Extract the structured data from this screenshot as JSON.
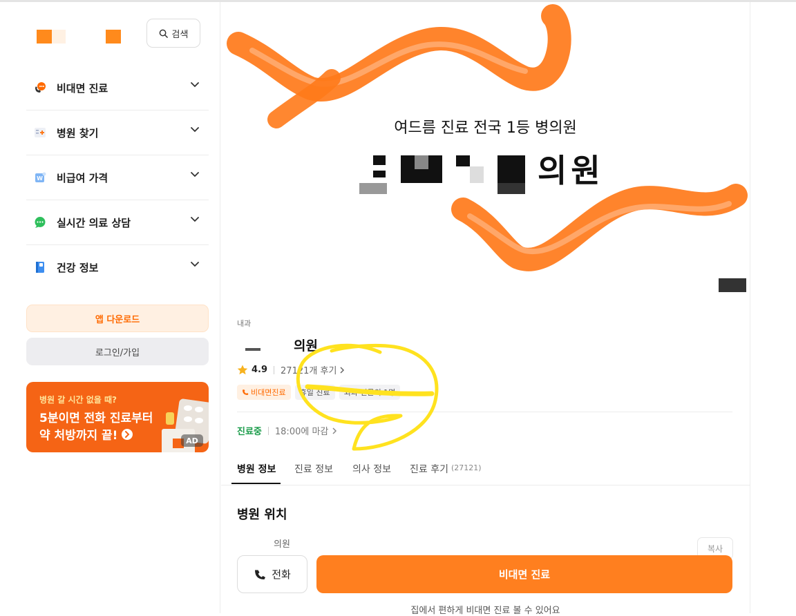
{
  "search": {
    "label": "검색"
  },
  "menu": [
    {
      "label": "비대면 진료",
      "icon": "phone-chat-icon"
    },
    {
      "label": "병원 찾기",
      "icon": "hospital-search-icon"
    },
    {
      "label": "비급여 가격",
      "icon": "price-tag-icon"
    },
    {
      "label": "실시간 의료 상담",
      "icon": "chat-bubble-icon"
    },
    {
      "label": "건강 정보",
      "icon": "book-icon"
    }
  ],
  "buttons": {
    "app_download": "앱 다운로드",
    "login": "로그인/가입"
  },
  "ad": {
    "question": "병원 갈 시간 없을 때?",
    "line1": "5분이면 전화 진료부터",
    "line2": "약 처방까지 끝!",
    "badge": "AD"
  },
  "hero": {
    "subtitle": "여드름 진료 전국 1등 병의원",
    "title_suffix": "의원"
  },
  "hospital": {
    "department": "내과",
    "name_suffix": "의원",
    "rating": "4.9",
    "reviews": "27121개 후기",
    "tags": [
      "비대면진료",
      "휴일 진료",
      "외과 전문의 1명"
    ],
    "status": "진료중",
    "hours": "18:00에 마감"
  },
  "tabs": [
    {
      "label": "병원 정보"
    },
    {
      "label": "진료 정보"
    },
    {
      "label": "의사 정보"
    },
    {
      "label": "진료 후기",
      "count": "(27121)"
    }
  ],
  "section": {
    "title": "병원 위치",
    "address": "의원",
    "copy": "복사"
  },
  "actions": {
    "call": "전화",
    "telemedicine": "비대면 진료",
    "note": "집에서 편하게 비대면 진료 볼 수 있어요"
  },
  "colors": {
    "accent": "#ff7f1f",
    "open": "#1a9c4a"
  }
}
